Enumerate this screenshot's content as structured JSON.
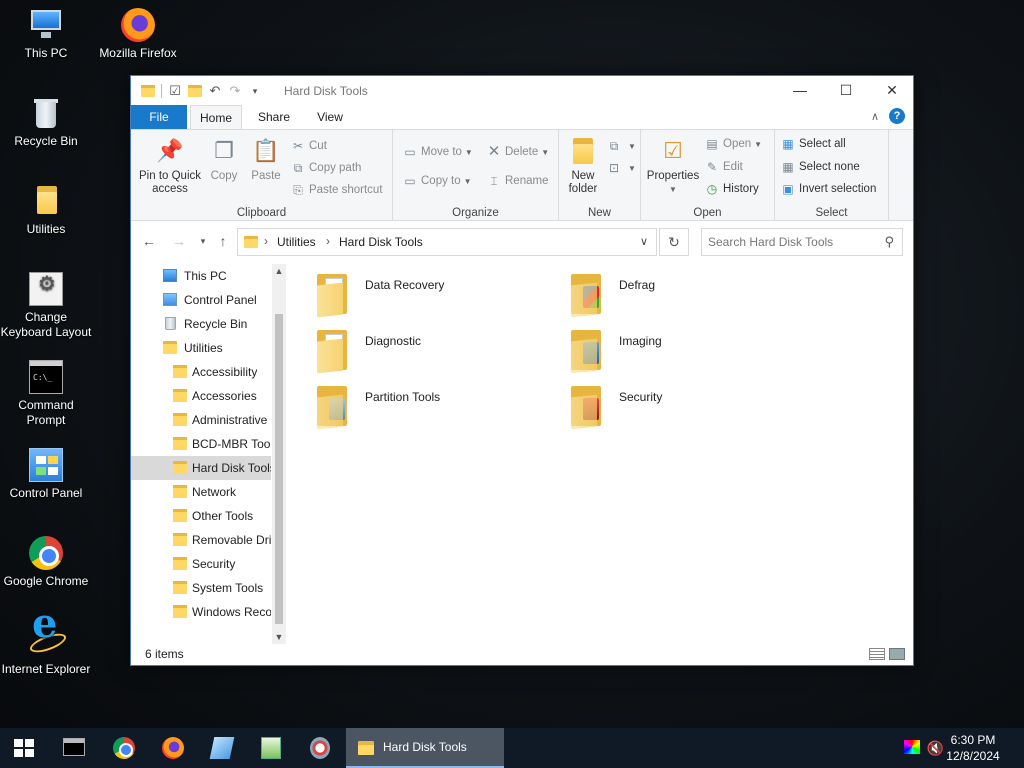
{
  "desktop": {
    "icons": [
      {
        "label": "This PC"
      },
      {
        "label": "Mozilla Firefox"
      },
      {
        "label": "Recycle Bin"
      },
      {
        "label": "Utilities"
      },
      {
        "label": "Change Keyboard Layout"
      },
      {
        "label": "Command Prompt"
      },
      {
        "label": "Control Panel"
      },
      {
        "label": "Google Chrome"
      },
      {
        "label": "Internet Explorer"
      }
    ]
  },
  "window": {
    "title": "Hard Disk Tools",
    "tabs": {
      "file": "File",
      "home": "Home",
      "share": "Share",
      "view": "View"
    },
    "ribbon": {
      "clipboard": {
        "label": "Clipboard",
        "pin": "Pin to Quick access",
        "copy": "Copy",
        "paste": "Paste",
        "cut": "Cut",
        "copy_path": "Copy path",
        "paste_shortcut": "Paste shortcut"
      },
      "organize": {
        "label": "Organize",
        "move_to": "Move to",
        "copy_to": "Copy to",
        "delete": "Delete",
        "rename": "Rename"
      },
      "new": {
        "label": "New",
        "new_folder": "New folder"
      },
      "open": {
        "label": "Open",
        "properties": "Properties",
        "open": "Open",
        "edit": "Edit",
        "history": "History"
      },
      "select": {
        "label": "Select",
        "select_all": "Select all",
        "select_none": "Select none",
        "invert": "Invert selection"
      }
    },
    "address": {
      "crumbs": [
        "Utilities",
        "Hard Disk Tools"
      ],
      "search_placeholder": "Search Hard Disk Tools"
    },
    "nav": [
      {
        "label": "This PC"
      },
      {
        "label": "Control Panel"
      },
      {
        "label": "Recycle Bin"
      },
      {
        "label": "Utilities"
      },
      {
        "label": "Accessibility"
      },
      {
        "label": "Accessories"
      },
      {
        "label": "Administrative"
      },
      {
        "label": "BCD-MBR Tool"
      },
      {
        "label": "Hard Disk Tools"
      },
      {
        "label": "Network"
      },
      {
        "label": "Other Tools"
      },
      {
        "label": "Removable Dri"
      },
      {
        "label": "Security"
      },
      {
        "label": "System Tools"
      },
      {
        "label": "Windows Reco"
      }
    ],
    "items": [
      {
        "name": "Data Recovery"
      },
      {
        "name": "Defrag"
      },
      {
        "name": "Diagnostic"
      },
      {
        "name": "Imaging"
      },
      {
        "name": "Partition Tools"
      },
      {
        "name": "Security"
      }
    ],
    "status": {
      "count": "6 items"
    }
  },
  "taskbar": {
    "active_label": "Hard Disk Tools",
    "time": "6:30 PM",
    "date": "12/8/2024"
  },
  "colors": {
    "accent": "#1979ca",
    "folder": "#f7c948",
    "taskbar": "#0f1a26"
  }
}
